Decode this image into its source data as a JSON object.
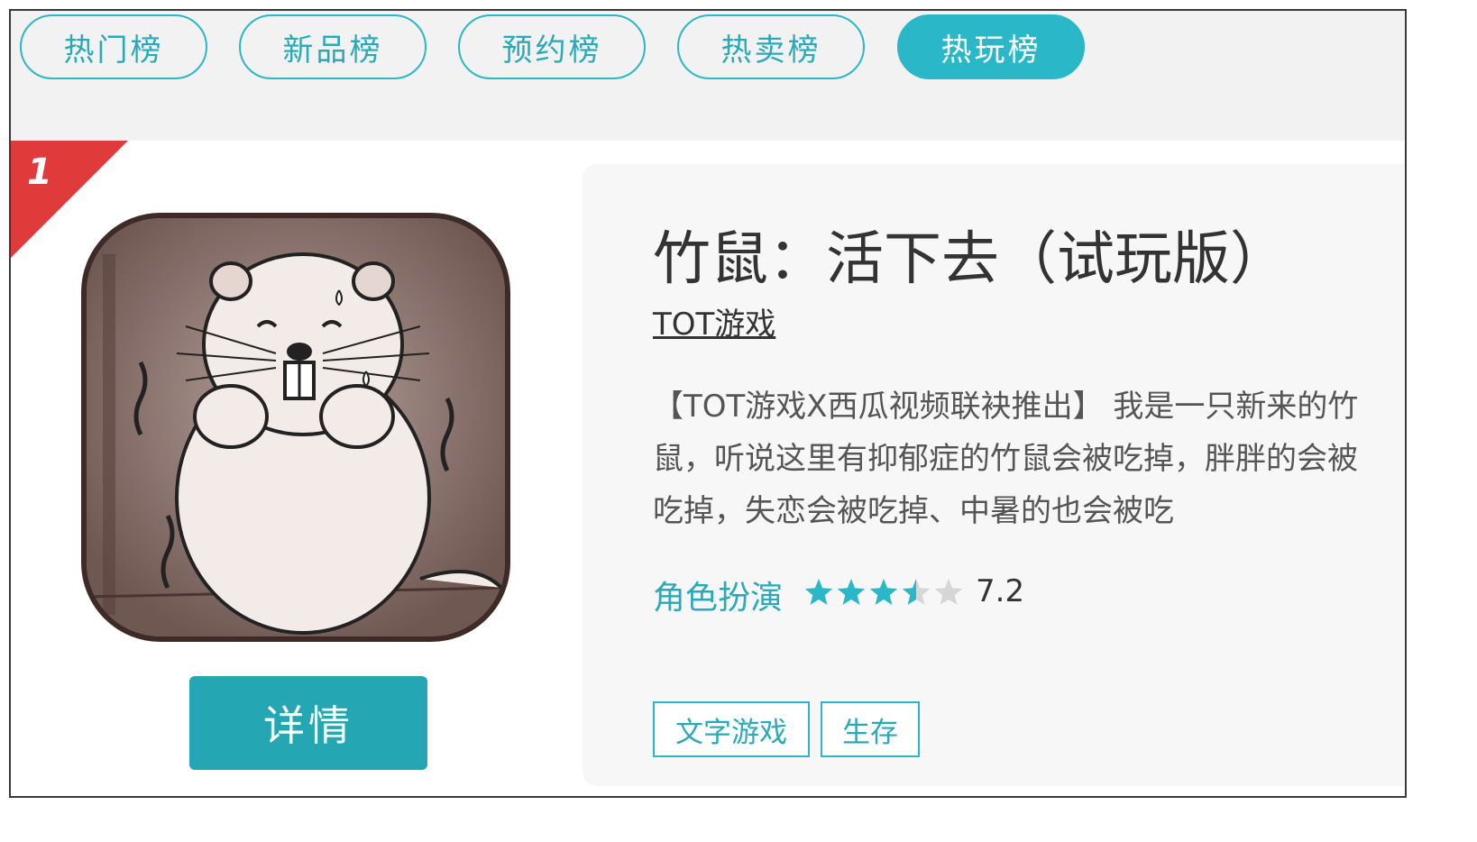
{
  "tabs": [
    {
      "label": "热门榜",
      "active": false
    },
    {
      "label": "新品榜",
      "active": false
    },
    {
      "label": "预约榜",
      "active": false
    },
    {
      "label": "热卖榜",
      "active": false
    },
    {
      "label": "热玩榜",
      "active": true
    }
  ],
  "item": {
    "rank": "1",
    "title": "竹鼠：活下去（试玩版）",
    "developer": "TOT游戏",
    "description": "【TOT游戏X西瓜视频联袂推出】 我是一只新来的竹鼠，听说这里有抑郁症的竹鼠会被吃掉，胖胖的会被吃掉，失恋会被吃掉、中暑的也会被吃",
    "genre": "角色扮演",
    "rating_stars": 3.5,
    "rating_max": 5,
    "score": "7.2",
    "tags": [
      "文字游戏",
      "生存"
    ],
    "detail_button": "详情",
    "icon": "bamboo-rat-game-icon"
  },
  "colors": {
    "accent": "#2ab7c7",
    "button": "#24a7b3",
    "rank_badge": "#e03a3a",
    "star_empty": "#d6d6d6"
  }
}
